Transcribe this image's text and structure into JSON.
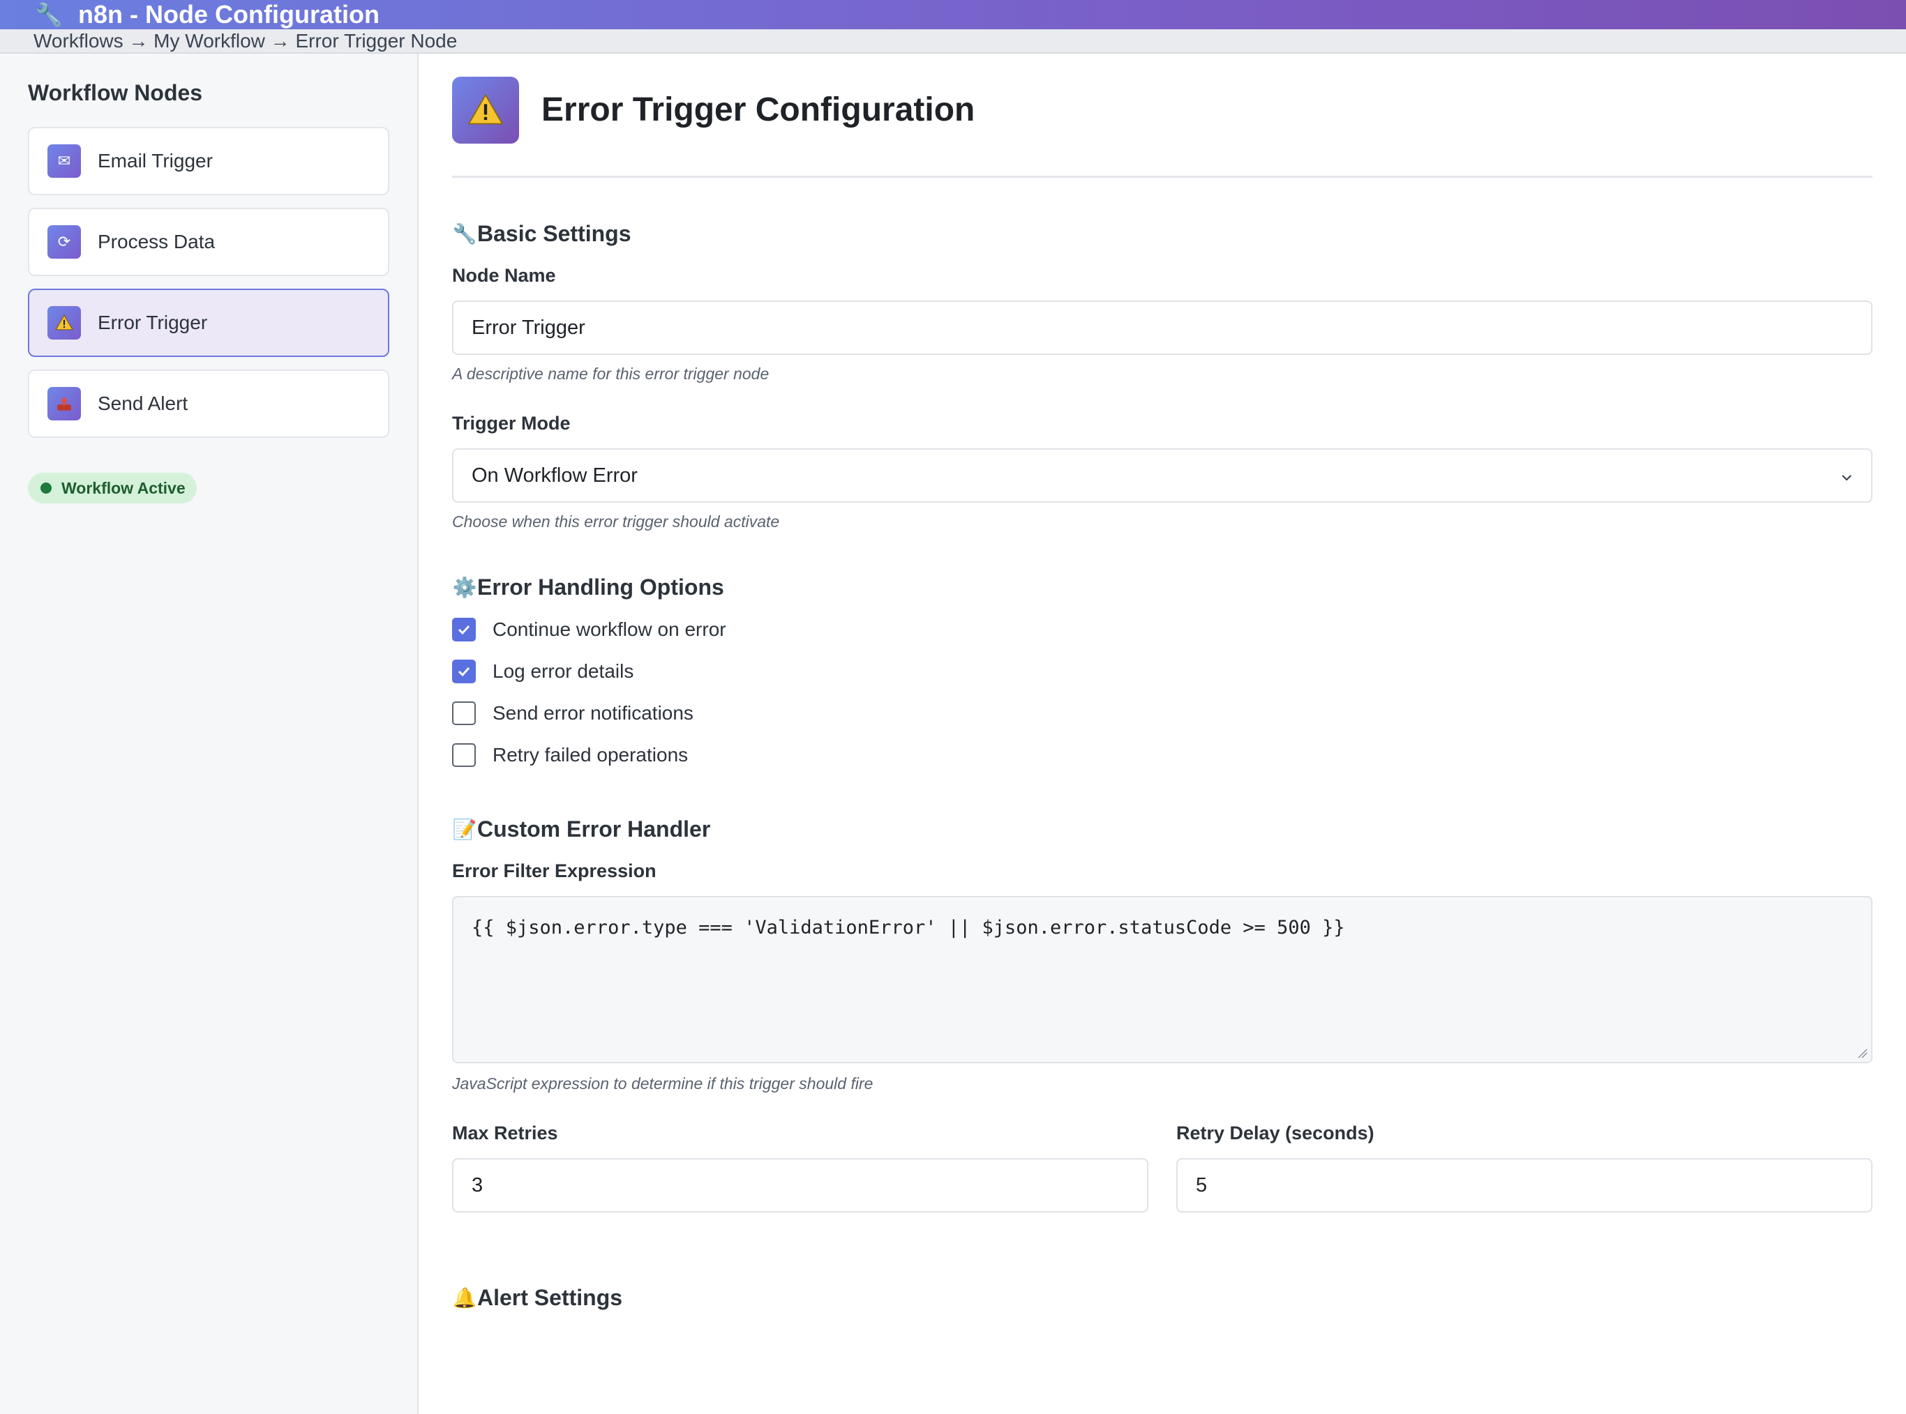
{
  "window": {
    "title": "n8n - Node Configuration",
    "icon": "wrench-icon"
  },
  "breadcrumb": "Workflows → My Workflow → Error Trigger Node",
  "sidebar": {
    "title": "Workflow Nodes",
    "items": [
      {
        "label": "Email Trigger",
        "icon": "envelope-icon",
        "active": false
      },
      {
        "label": "Process Data",
        "icon": "refresh-icon",
        "active": false
      },
      {
        "label": "Error Trigger",
        "icon": "warning-icon",
        "active": true
      },
      {
        "label": "Send Alert",
        "icon": "outbox-icon",
        "active": false
      }
    ],
    "status": "Workflow Active"
  },
  "main": {
    "title": "Error Trigger Configuration",
    "basic": {
      "heading": "Basic Settings",
      "node_name_label": "Node Name",
      "node_name_value": "Error Trigger",
      "node_name_hint": "A descriptive name for this error trigger node",
      "trigger_mode_label": "Trigger Mode",
      "trigger_mode_value": "On Workflow Error",
      "trigger_mode_hint": "Choose when this error trigger should activate"
    },
    "error_handling": {
      "heading": "Error Handling Options",
      "options": [
        {
          "label": "Continue workflow on error",
          "checked": true
        },
        {
          "label": "Log error details",
          "checked": true
        },
        {
          "label": "Send error notifications",
          "checked": false
        },
        {
          "label": "Retry failed operations",
          "checked": false
        }
      ]
    },
    "custom": {
      "heading": "Custom Error Handler",
      "expr_label": "Error Filter Expression",
      "expr_value": "{{ $json.error.type === 'ValidationError' || $json.error.statusCode >= 500 }}",
      "expr_hint": "JavaScript expression to determine if this trigger should fire",
      "max_retries_label": "Max Retries",
      "max_retries_value": "3",
      "retry_delay_label": "Retry Delay (seconds)",
      "retry_delay_value": "5"
    },
    "alert": {
      "heading": "Alert Settings"
    }
  },
  "colors": {
    "accent": "#5a6fe0",
    "active_card_bg": "#ece8f7",
    "status_green": "#1f7a3b"
  }
}
